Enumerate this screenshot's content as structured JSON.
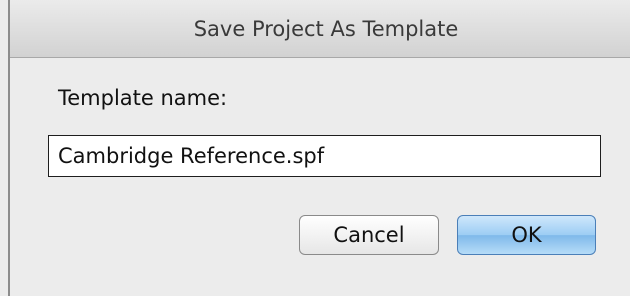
{
  "dialog": {
    "title": "Save Project As Template",
    "label": "Template name:",
    "name_value": "Cambridge Reference.spf",
    "cancel_label": "Cancel",
    "ok_label": "OK"
  }
}
